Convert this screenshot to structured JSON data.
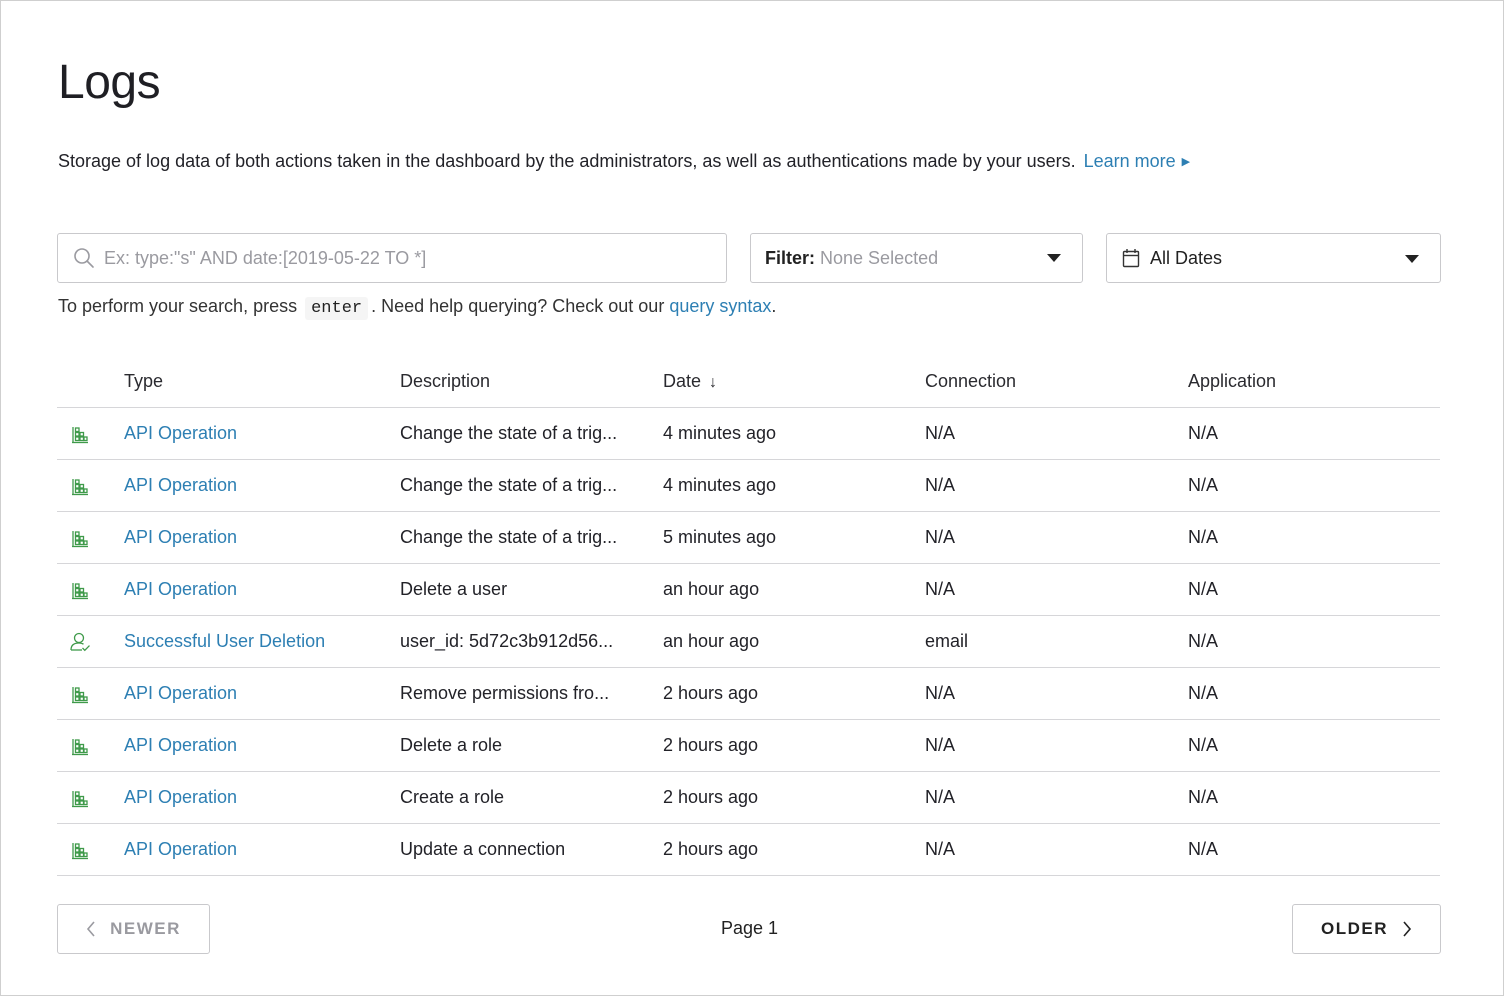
{
  "page": {
    "title": "Logs",
    "description": "Storage of log data of both actions taken in the dashboard by the administrators, as well as authentications made by your users.",
    "learn_more": "Learn more"
  },
  "search": {
    "placeholder": "Ex: type:\"s\" AND date:[2019-05-22 TO *]",
    "value": ""
  },
  "filter": {
    "label": "Filter:",
    "value": "None Selected"
  },
  "dates": {
    "value": "All Dates"
  },
  "help": {
    "prefix": "To perform your search, press",
    "key": "enter",
    "middle": ". Need help querying? Check out our",
    "link": "query syntax",
    "suffix": "."
  },
  "table": {
    "columns": {
      "type": "Type",
      "description": "Description",
      "date": "Date",
      "connection": "Connection",
      "application": "Application"
    },
    "sort_indicator": "↓",
    "rows": [
      {
        "icon": "api-operation-icon",
        "type": "API Operation",
        "description": "Change the state of a trig...",
        "date": "4 minutes ago",
        "connection": "N/A",
        "application": "N/A"
      },
      {
        "icon": "api-operation-icon",
        "type": "API Operation",
        "description": "Change the state of a trig...",
        "date": "4 minutes ago",
        "connection": "N/A",
        "application": "N/A"
      },
      {
        "icon": "api-operation-icon",
        "type": "API Operation",
        "description": "Change the state of a trig...",
        "date": "5 minutes ago",
        "connection": "N/A",
        "application": "N/A"
      },
      {
        "icon": "api-operation-icon",
        "type": "API Operation",
        "description": "Delete a user",
        "date": "an hour ago",
        "connection": "N/A",
        "application": "N/A"
      },
      {
        "icon": "user-check-icon",
        "type": "Successful User Deletion",
        "description": "user_id: 5d72c3b912d56...",
        "date": "an hour ago",
        "connection": "email",
        "application": "N/A"
      },
      {
        "icon": "api-operation-icon",
        "type": "API Operation",
        "description": "Remove permissions fro...",
        "date": "2 hours ago",
        "connection": "N/A",
        "application": "N/A"
      },
      {
        "icon": "api-operation-icon",
        "type": "API Operation",
        "description": "Delete a role",
        "date": "2 hours ago",
        "connection": "N/A",
        "application": "N/A"
      },
      {
        "icon": "api-operation-icon",
        "type": "API Operation",
        "description": "Create a role",
        "date": "2 hours ago",
        "connection": "N/A",
        "application": "N/A"
      },
      {
        "icon": "api-operation-icon",
        "type": "API Operation",
        "description": "Update a connection",
        "date": "2 hours ago",
        "connection": "N/A",
        "application": "N/A"
      }
    ]
  },
  "pagination": {
    "newer": "NEWER",
    "older": "OLDER",
    "page": "Page 1"
  },
  "colors": {
    "link": "#2d7fb3",
    "icon_green": "#3f9a4a",
    "border": "#d6d6d9"
  }
}
